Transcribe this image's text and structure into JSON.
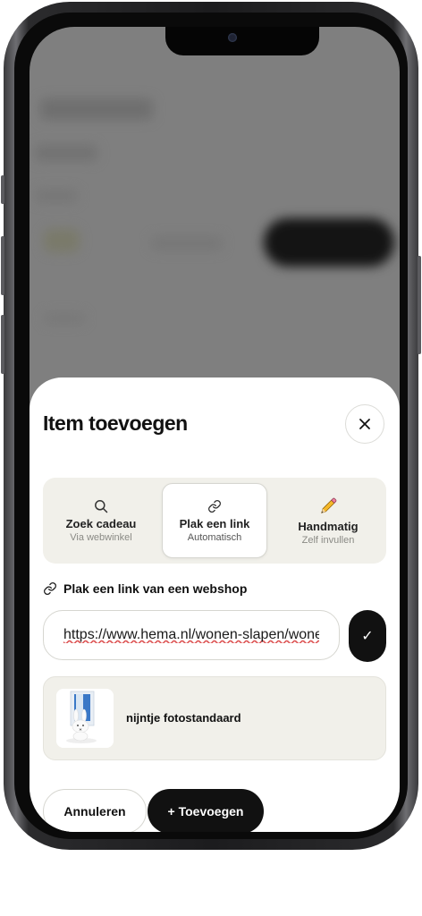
{
  "sheet": {
    "title": "Item toevoegen",
    "close_icon": "close-icon"
  },
  "tabs": [
    {
      "label": "Zoek cadeau",
      "sub": "Via webwinkel",
      "icon": "search-icon",
      "active": false
    },
    {
      "label": "Plak een link",
      "sub": "Automatisch",
      "icon": "link-icon",
      "active": true
    },
    {
      "label": "Handmatig",
      "sub": "Zelf invullen",
      "icon": "pencil-icon",
      "active": false
    }
  ],
  "link_section": {
    "label": "Plak een link van een webshop",
    "icon": "link-icon",
    "url_value": "https://www.hema.nl/wonen-slapen/wonen",
    "confirm_label": "✓"
  },
  "preview": {
    "product_name": "nijntje fotostandaard"
  },
  "actions": {
    "cancel_label": "Annuleren",
    "add_label": "+ Toevoegen"
  },
  "colors": {
    "accent": "#111111",
    "panel": "#f1f0ea",
    "backdrop": "#7f7f7f"
  }
}
